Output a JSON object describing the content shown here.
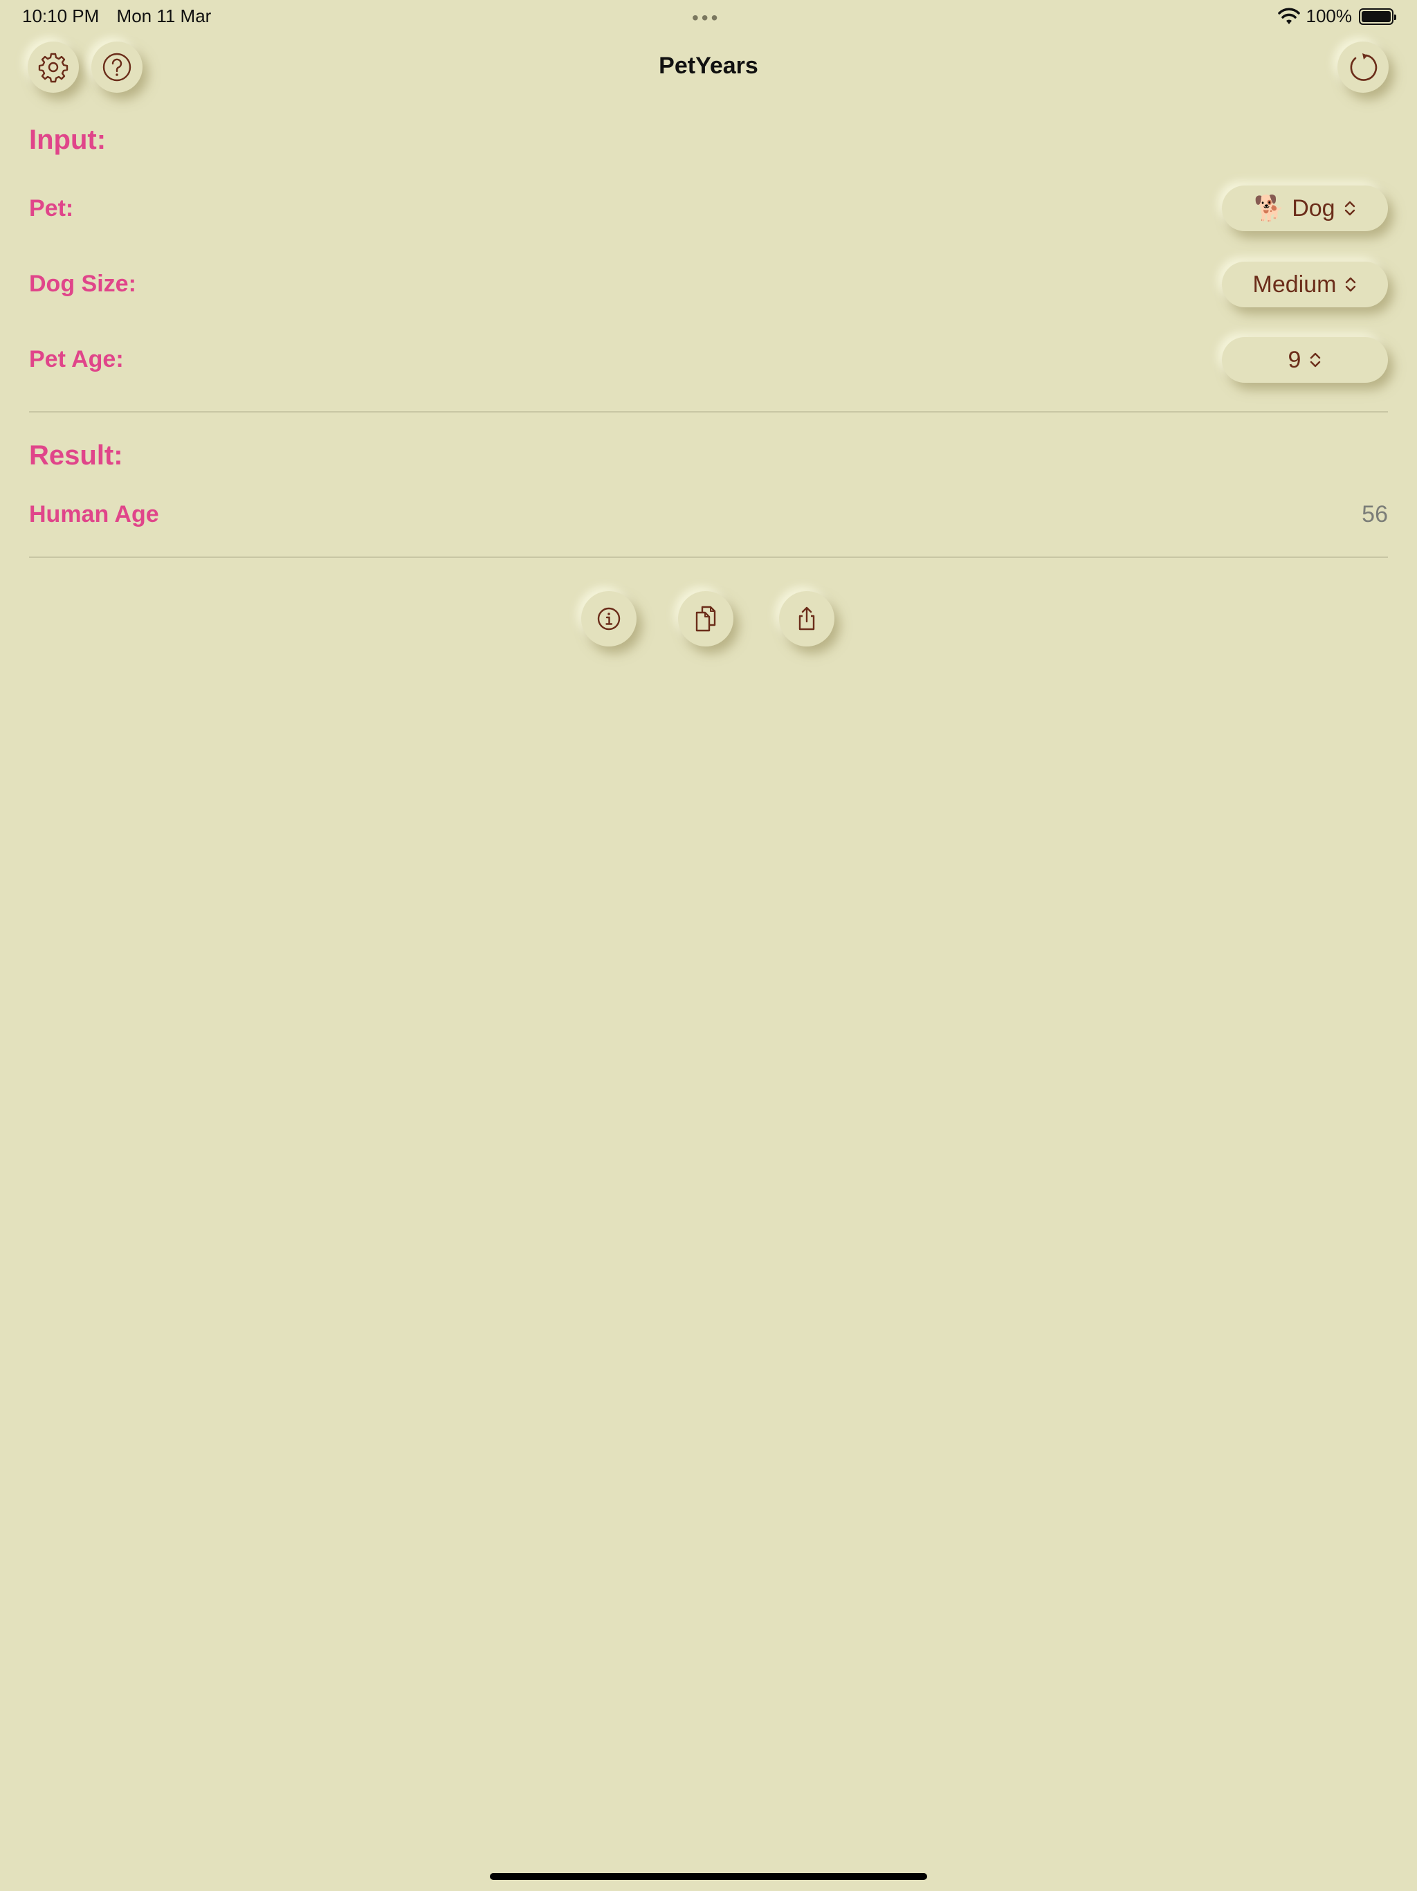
{
  "status_bar": {
    "time": "10:10 PM",
    "date": "Mon 11 Mar",
    "battery": "100%",
    "dots": "•••"
  },
  "nav": {
    "title": "PetYears",
    "settings_icon": "gear-icon",
    "help_icon": "question-circle-icon",
    "reset_icon": "refresh-icon"
  },
  "input": {
    "heading": "Input:",
    "pet_label": "Pet:",
    "pet_value": "Dog",
    "pet_icon": "🐕",
    "size_label": "Dog Size:",
    "size_value": "Medium",
    "age_label": "Pet Age:",
    "age_value": "9"
  },
  "result": {
    "heading": "Result:",
    "human_age_label": "Human Age",
    "human_age_value": "56"
  },
  "actions": {
    "info_icon": "info-icon",
    "copy_icon": "copy-icon",
    "share_icon": "share-icon"
  },
  "colors": {
    "background": "#e3e1bd",
    "accent": "#e0458a",
    "icon": "#6b2d1a",
    "value_gray": "#7b7d78"
  }
}
